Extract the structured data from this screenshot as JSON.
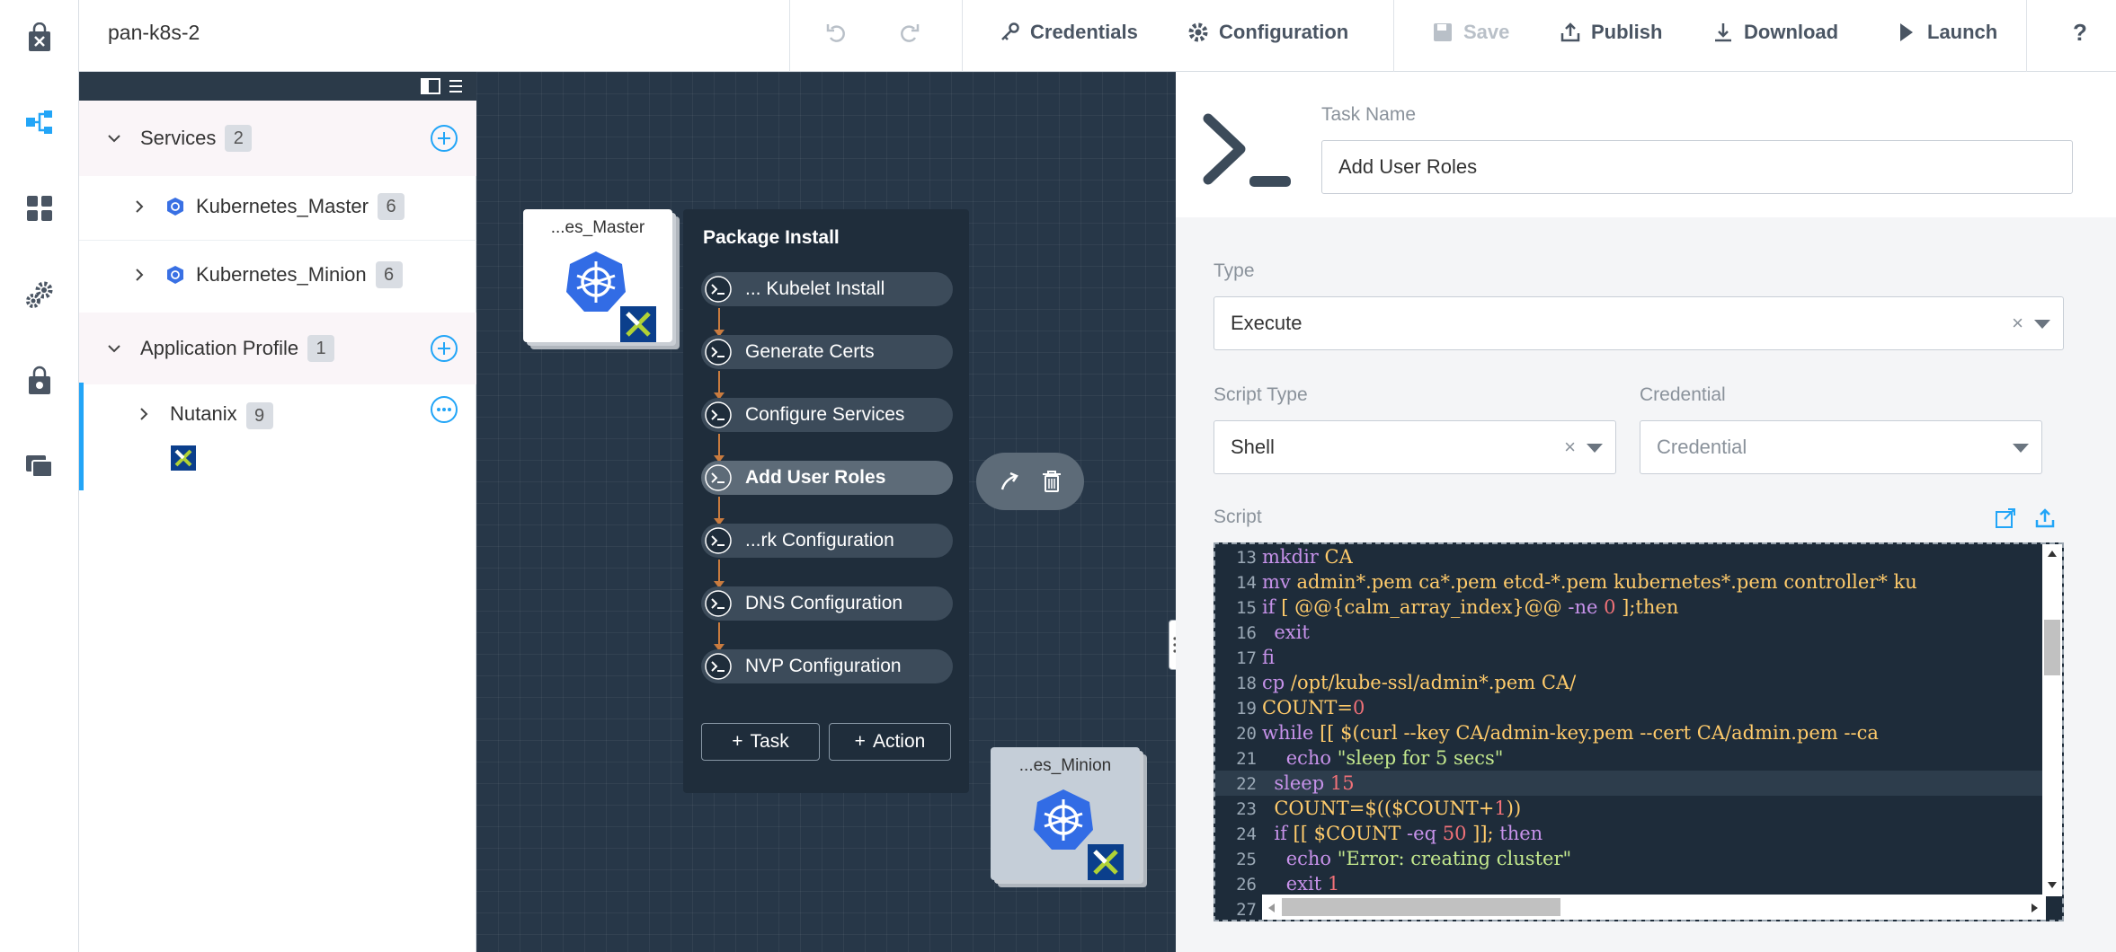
{
  "app": {
    "blueprint_name": "pan-k8s-2"
  },
  "toolbar": {
    "credentials": "Credentials",
    "configuration": "Configuration",
    "save": "Save",
    "publish": "Publish",
    "download": "Download",
    "launch": "Launch",
    "help": "?"
  },
  "sidebar": {
    "items": [
      {
        "icon": "marketplace-bag-icon"
      },
      {
        "icon": "blueprint-icon",
        "active": true
      },
      {
        "icon": "apps-grid-icon"
      },
      {
        "icon": "settings-gears-icon"
      },
      {
        "icon": "lock-bag-icon"
      },
      {
        "icon": "projects-folder-icon"
      }
    ]
  },
  "services_panel": {
    "services_label": "Services",
    "services_count": "2",
    "services": [
      {
        "name": "Kubernetes_Master",
        "count": "6"
      },
      {
        "name": "Kubernetes_Minion",
        "count": "6"
      }
    ],
    "app_profile_label": "Application Profile",
    "app_profile_count": "1",
    "profiles": [
      {
        "name": "Nutanix",
        "count": "9"
      }
    ]
  },
  "canvas": {
    "master_card": "...es_Master",
    "minion_card": "...es_Minion",
    "package": {
      "title": "Package Install",
      "tasks": [
        "... Kubelet Install",
        "Generate Certs",
        "Configure Services",
        "Add User Roles",
        "...rk Configuration",
        "DNS Configuration",
        "NVP Configuration"
      ],
      "selected_task": "Add User Roles",
      "add_task": "Task",
      "add_action": "Action"
    }
  },
  "editor": {
    "task_name_label": "Task Name",
    "task_name_value": "Add User Roles",
    "type_label": "Type",
    "type_value": "Execute",
    "script_type_label": "Script Type",
    "script_type_value": "Shell",
    "credential_label": "Credential",
    "credential_placeholder": "Credential",
    "script_label": "Script",
    "clear_glyph": "×",
    "script_lines": [
      {
        "n": "13",
        "text": "mkdir CA"
      },
      {
        "n": "14",
        "text": "mv admin*.pem ca*.pem etcd-*.pem kubernetes*.pem controller* ku"
      },
      {
        "n": "15",
        "text": "if [ @@{calm_array_index}@@ -ne 0 ];then"
      },
      {
        "n": "16",
        "text": "  exit"
      },
      {
        "n": "17",
        "text": "fi"
      },
      {
        "n": "18",
        "text": "cp /opt/kube-ssl/admin*.pem CA/"
      },
      {
        "n": "19",
        "text": "COUNT=0"
      },
      {
        "n": "20",
        "text": "while [[ $(curl --key CA/admin-key.pem --cert CA/admin.pem --ca"
      },
      {
        "n": "21",
        "text": "    echo \"sleep for 5 secs\""
      },
      {
        "n": "22",
        "text": "  sleep 15"
      },
      {
        "n": "23",
        "text": "  COUNT=$(($COUNT+1))"
      },
      {
        "n": "24",
        "text": "  if [[ $COUNT -eq 50 ]]; then"
      },
      {
        "n": "25",
        "text": "    echo \"Error: creating cluster\""
      },
      {
        "n": "26",
        "text": "    exit 1"
      },
      {
        "n": "27",
        "text": ""
      }
    ]
  },
  "colors": {
    "accent": "#22a5f7",
    "canvas_bg": "#273748",
    "code_keyword": "#c792ea",
    "code_text": "#ffcb6b",
    "code_number": "#f07178",
    "code_string": "#c3e88d"
  }
}
